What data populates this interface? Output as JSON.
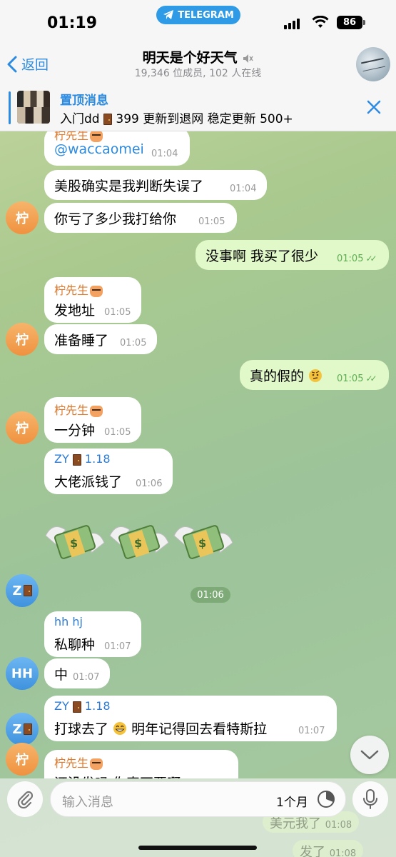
{
  "status": {
    "time": "01:19",
    "app_pill": "TELEGRAM",
    "battery": "86"
  },
  "header": {
    "back_label": "返回",
    "title": "明天是个好天气",
    "subtitle": "19,346 位成员, 102 人在线"
  },
  "pinned": {
    "label": "置顶消息",
    "text_prefix": "入门dd",
    "text_suffix": "399 更新到退网 稳定更新 500+"
  },
  "messages": [
    {
      "sender": "柠先生",
      "text": "@waccaomei",
      "time": "01:04"
    },
    {
      "text": "美股确实是我判断失误了",
      "time": "01:04"
    },
    {
      "text": "你亏了多少我打给你",
      "time": "01:05",
      "avatar": "柠"
    },
    {
      "text": "没事啊 我买了很少",
      "time": "01:05",
      "outgoing": true
    },
    {
      "sender": "柠先生",
      "text": "发地址",
      "time": "01:05"
    },
    {
      "text": "准备睡了",
      "time": "01:05",
      "avatar": "柠"
    },
    {
      "text": "真的假的",
      "time": "01:05",
      "outgoing": true
    },
    {
      "sender": "柠先生",
      "text": "一分钟",
      "time": "01:05",
      "avatar": "柠"
    },
    {
      "sender": "ZY",
      "sender_suffix": "1.18",
      "text": "大佬派钱了",
      "time": "01:06"
    },
    {
      "time": "01:06",
      "avatar": "Z"
    },
    {
      "sender": "hh hj",
      "text": "私聊种",
      "time": "01:07"
    },
    {
      "text": "中",
      "time": "01:07",
      "avatar": "HH"
    },
    {
      "sender": "ZY",
      "sender_suffix": "1.18",
      "text": "打球去了",
      "text_suffix": "明年记得回去看特斯拉",
      "time": "01:07",
      "avatar": "Z"
    },
    {
      "sender": "柠先生",
      "text": "还没发吗 你真不要啊",
      "avatar": "柠"
    }
  ],
  "ghost_messages": [
    {
      "text": "美元我了",
      "time": "01:08"
    },
    {
      "text": "发了",
      "time": "01:08"
    }
  ],
  "composer": {
    "placeholder": "输入消息",
    "timer_label": "1个月"
  },
  "colors": {
    "accent": "#2c8be0",
    "sender_orange": "#e07a2c",
    "sender_blue": "#2c7bd6",
    "outgoing_bubble": "#e1f8c8"
  },
  "icons": [
    "chevron-left-icon",
    "mute-icon",
    "close-icon",
    "paperclip-icon",
    "timer-icon",
    "microphone-icon",
    "chevron-down-icon",
    "door-emoji",
    "cat-emoji",
    "money-with-wings-emoji",
    "grinning-emoji",
    "raised-eyebrow-emoji"
  ]
}
